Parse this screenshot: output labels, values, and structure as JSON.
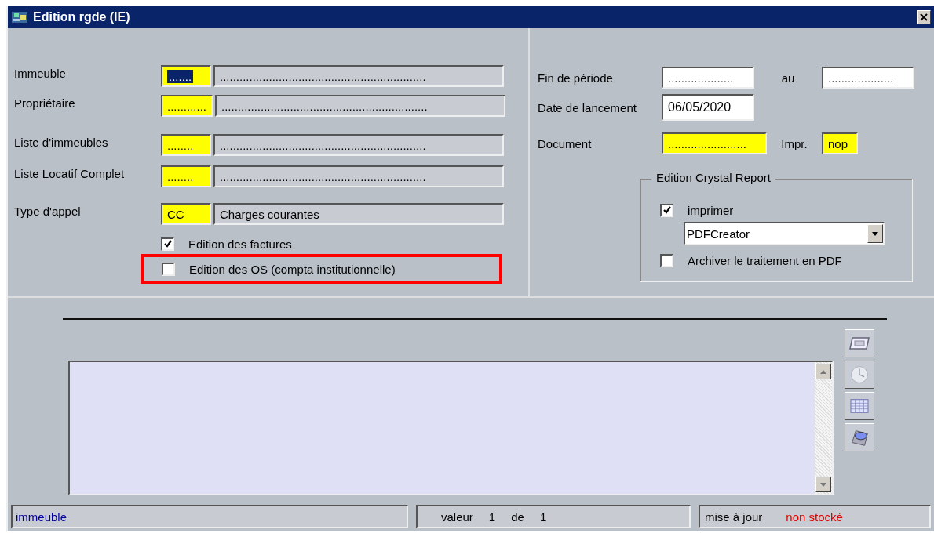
{
  "window": {
    "title": "Edition rgde (IE)"
  },
  "left_rows": [
    {
      "label": "Immeuble",
      "code": {
        "value": ".......",
        "kind": "required",
        "focused": true
      },
      "description": {
        "value": "...............................................................",
        "kind": "readonly"
      }
    },
    {
      "label": "Propriétaire",
      "code": {
        "value": "............",
        "kind": "required",
        "focused": false
      },
      "description": {
        "value": "...............................................................",
        "kind": "readonly"
      }
    },
    {
      "label": "Liste d'immeubles",
      "code": {
        "value": "........",
        "kind": "required",
        "focused": false
      },
      "description": {
        "value": "...............................................................",
        "kind": "readonly"
      }
    },
    {
      "label": "Liste Locatif Complet",
      "code": {
        "value": "........",
        "kind": "required",
        "focused": false
      },
      "description": {
        "value": "...............................................................",
        "kind": "readonly"
      }
    },
    {
      "label": "Type d'appel",
      "code": {
        "value": "CC",
        "kind": "required",
        "focused": false
      },
      "description": {
        "value": "Charges courantes",
        "kind": "readonly"
      }
    }
  ],
  "left_checkboxes": [
    {
      "label": "Edition des factures",
      "checked": true,
      "highlighted": false
    },
    {
      "label": "Edition des OS  (compta institutionnelle)",
      "checked": false,
      "highlighted": true
    }
  ],
  "period": {
    "label": "Fin de période",
    "from": {
      "value": "....................",
      "kind": "input"
    },
    "to_label": "au",
    "to": {
      "value": "....................",
      "kind": "input"
    }
  },
  "launch_date": {
    "label": "Date de lancement",
    "field": {
      "value": "06/05/2020",
      "kind": "input"
    }
  },
  "document": {
    "label": "Document",
    "field": {
      "value": "........................",
      "kind": "required"
    },
    "printer_label": "Impr.",
    "printer": {
      "value": "nop",
      "kind": "required"
    }
  },
  "crystal_report": {
    "title": "Edition Crystal Report",
    "print": {
      "label": "imprimer",
      "checked": true
    },
    "printer_select": {
      "value": "PDFCreator"
    },
    "archive": {
      "label": "Archiver le traitement en PDF",
      "checked": false
    }
  },
  "status_bar": {
    "field": "immeuble",
    "value_label": "valeur",
    "current": "1",
    "of_label": "de",
    "total": "1",
    "update_label": "mise à jour",
    "update_state": "non stocké"
  }
}
